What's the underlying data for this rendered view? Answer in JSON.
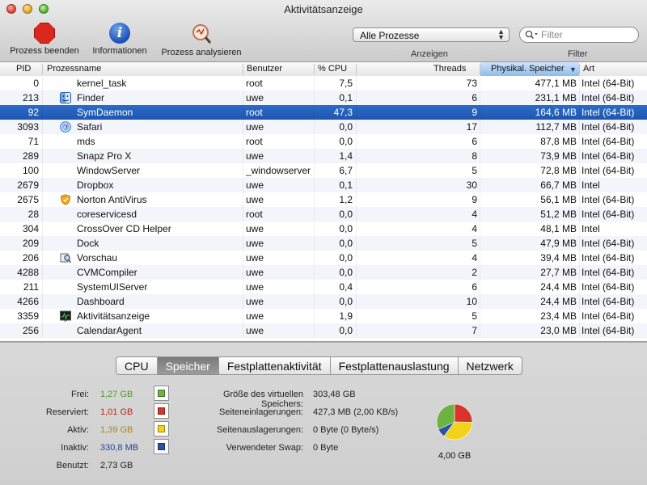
{
  "window": {
    "title": "Aktivitätsanzeige"
  },
  "toolbar": {
    "quit_label": "Prozess beenden",
    "info_label": "Informationen",
    "inspect_label": "Prozess analysieren",
    "filter_select": "Alle Prozesse",
    "search_placeholder": "Filter",
    "show_label": "Anzeigen",
    "filter_label": "Filter"
  },
  "columns": {
    "pid": "PID",
    "name": "Prozessname",
    "user": "Benutzer",
    "cpu": "% CPU",
    "threads": "Threads",
    "memory": "Physikal. Speicher",
    "kind": "Art"
  },
  "processes": [
    {
      "pid": "0",
      "name": "kernel_task",
      "user": "root",
      "cpu": "7,5",
      "threads": "73",
      "memory": "477,1 MB",
      "kind": "Intel (64-Bit)",
      "icon": ""
    },
    {
      "pid": "213",
      "name": "Finder",
      "user": "uwe",
      "cpu": "0,1",
      "threads": "6",
      "memory": "231,1 MB",
      "kind": "Intel (64-Bit)",
      "icon": "finder-icon"
    },
    {
      "pid": "92",
      "name": "SymDaemon",
      "user": "root",
      "cpu": "47,3",
      "threads": "9",
      "memory": "164,6 MB",
      "kind": "Intel (64-Bit)",
      "icon": ""
    },
    {
      "pid": "3093",
      "name": "Safari",
      "user": "uwe",
      "cpu": "0,0",
      "threads": "17",
      "memory": "112,7 MB",
      "kind": "Intel (64-Bit)",
      "icon": "safari-icon"
    },
    {
      "pid": "71",
      "name": "mds",
      "user": "root",
      "cpu": "0,0",
      "threads": "6",
      "memory": "87,8 MB",
      "kind": "Intel (64-Bit)",
      "icon": ""
    },
    {
      "pid": "289",
      "name": "Snapz Pro X",
      "user": "uwe",
      "cpu": "1,4",
      "threads": "8",
      "memory": "73,9 MB",
      "kind": "Intel (64-Bit)",
      "icon": ""
    },
    {
      "pid": "100",
      "name": "WindowServer",
      "user": "_windowserver",
      "cpu": "6,7",
      "threads": "5",
      "memory": "72,8 MB",
      "kind": "Intel (64-Bit)",
      "icon": ""
    },
    {
      "pid": "2679",
      "name": "Dropbox",
      "user": "uwe",
      "cpu": "0,1",
      "threads": "30",
      "memory": "66,7 MB",
      "kind": "Intel",
      "icon": ""
    },
    {
      "pid": "2675",
      "name": "Norton AntiVirus",
      "user": "uwe",
      "cpu": "1,2",
      "threads": "9",
      "memory": "56,1 MB",
      "kind": "Intel (64-Bit)",
      "icon": "norton-icon"
    },
    {
      "pid": "28",
      "name": "coreservicesd",
      "user": "root",
      "cpu": "0,0",
      "threads": "4",
      "memory": "51,2 MB",
      "kind": "Intel (64-Bit)",
      "icon": ""
    },
    {
      "pid": "304",
      "name": "CrossOver CD Helper",
      "user": "uwe",
      "cpu": "0,0",
      "threads": "4",
      "memory": "48,1 MB",
      "kind": "Intel",
      "icon": ""
    },
    {
      "pid": "209",
      "name": "Dock",
      "user": "uwe",
      "cpu": "0,0",
      "threads": "5",
      "memory": "47,9 MB",
      "kind": "Intel (64-Bit)",
      "icon": ""
    },
    {
      "pid": "206",
      "name": "Vorschau",
      "user": "uwe",
      "cpu": "0,0",
      "threads": "4",
      "memory": "39,4 MB",
      "kind": "Intel (64-Bit)",
      "icon": "preview-icon"
    },
    {
      "pid": "4288",
      "name": "CVMCompiler",
      "user": "uwe",
      "cpu": "0,0",
      "threads": "2",
      "memory": "27,7 MB",
      "kind": "Intel (64-Bit)",
      "icon": ""
    },
    {
      "pid": "211",
      "name": "SystemUIServer",
      "user": "uwe",
      "cpu": "0,4",
      "threads": "6",
      "memory": "24,4 MB",
      "kind": "Intel (64-Bit)",
      "icon": ""
    },
    {
      "pid": "4266",
      "name": "Dashboard",
      "user": "uwe",
      "cpu": "0,0",
      "threads": "10",
      "memory": "24,4 MB",
      "kind": "Intel (64-Bit)",
      "icon": ""
    },
    {
      "pid": "3359",
      "name": "Aktivitätsanzeige",
      "user": "uwe",
      "cpu": "1,9",
      "threads": "5",
      "memory": "23,4 MB",
      "kind": "Intel (64-Bit)",
      "icon": "activity-monitor-icon"
    },
    {
      "pid": "256",
      "name": "CalendarAgent",
      "user": "uwe",
      "cpu": "0,0",
      "threads": "7",
      "memory": "23,0 MB",
      "kind": "Intel (64-Bit)",
      "icon": ""
    }
  ],
  "selected_pid": "92",
  "tabs": [
    "CPU",
    "Speicher",
    "Festplattenaktivität",
    "Festplattenauslastung",
    "Netzwerk"
  ],
  "active_tab": "Speicher",
  "memory": {
    "stats": [
      {
        "label": "Frei:",
        "value": "1,27 GB",
        "color": "#6db33f"
      },
      {
        "label": "Reserviert:",
        "value": "1,01 GB",
        "color": "#d9342b"
      },
      {
        "label": "Aktiv:",
        "value": "1,39 GB",
        "color": "#f2d21b"
      },
      {
        "label": "Inaktiv:",
        "value": "330,8 MB",
        "color": "#2a52a8"
      }
    ],
    "used_label": "Benutzt:",
    "used_value": "2,73 GB",
    "vm": [
      {
        "label": "Größe des virtuellen Speichers:",
        "value": "303,48 GB"
      },
      {
        "label": "Seiteneinlagerungen:",
        "value": "427,3 MB (2,00 KB/s)"
      },
      {
        "label": "Seitenauslagerungen:",
        "value": "0 Byte (0 Byte/s)"
      },
      {
        "label": "Verwendeter Swap:",
        "value": "0 Byte"
      }
    ],
    "total": "4,00 GB"
  },
  "colors": {
    "selection": "#1f5bb8",
    "sort_header": "#9cc3ee"
  }
}
